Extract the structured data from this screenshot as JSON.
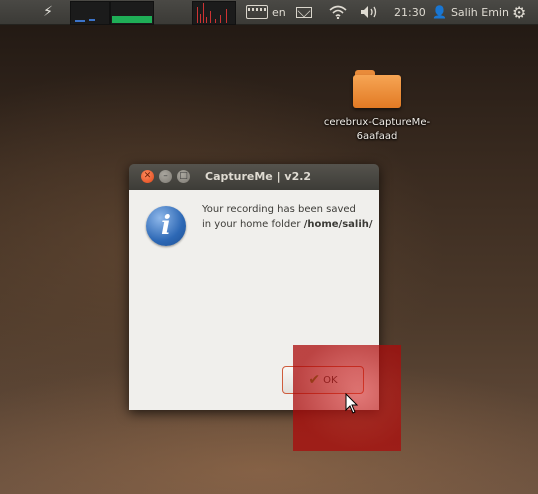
{
  "panel": {
    "lang": "en",
    "clock": "21:30",
    "user": "Salih Emin",
    "icons": [
      "bolt-icon",
      "cpu-graph",
      "memory-graph",
      "network-graph",
      "keyboard-icon",
      "mail-icon",
      "wifi-icon",
      "volume-icon",
      "user-icon",
      "gear-icon"
    ]
  },
  "desktop": {
    "folder_label_line1": "cerebrux-CaptureMe-",
    "folder_label_line2": "6aafaad"
  },
  "dialog": {
    "title": "CaptureMe | v2.2",
    "message_line1": "Your recording has been saved",
    "message_line2_prefix": "in your home folder ",
    "message_path": "/home/salih/",
    "ok_label": "OK"
  },
  "colors": {
    "panel": "#3b3a36",
    "dialog_bg": "#f0efec",
    "close_button": "#e0471a",
    "folder": "#f6a554",
    "highlight": "#d71919",
    "info_icon": "#2d68b5",
    "ok_check": "#58a333"
  }
}
